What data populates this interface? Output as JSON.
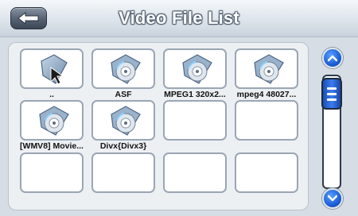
{
  "header": {
    "title": "Video File List",
    "back_icon": "back-arrow-icon"
  },
  "grid": {
    "items": [
      {
        "label": "..",
        "icon": "folder-up-icon"
      },
      {
        "label": "ASF",
        "icon": "video-file-icon"
      },
      {
        "label": "MPEG1 320x2...",
        "icon": "video-file-icon"
      },
      {
        "label": "mpeg4 48027...",
        "icon": "video-file-icon"
      },
      {
        "label": "[WMV8] Movie...",
        "icon": "video-file-icon"
      },
      {
        "label": "Divx{Divx3}",
        "icon": "video-file-icon"
      },
      {
        "label": "",
        "icon": ""
      },
      {
        "label": "",
        "icon": ""
      },
      {
        "label": "",
        "icon": ""
      },
      {
        "label": "",
        "icon": ""
      },
      {
        "label": "",
        "icon": ""
      },
      {
        "label": "",
        "icon": ""
      }
    ]
  },
  "scrollbar": {
    "up_icon": "chevron-up-icon",
    "down_icon": "chevron-down-icon",
    "thumb_icon": "grip-icon"
  },
  "colors": {
    "accent": "#1c5fd6",
    "header_bg": "#dde4eb",
    "cell_border": "#9aa6b4"
  }
}
